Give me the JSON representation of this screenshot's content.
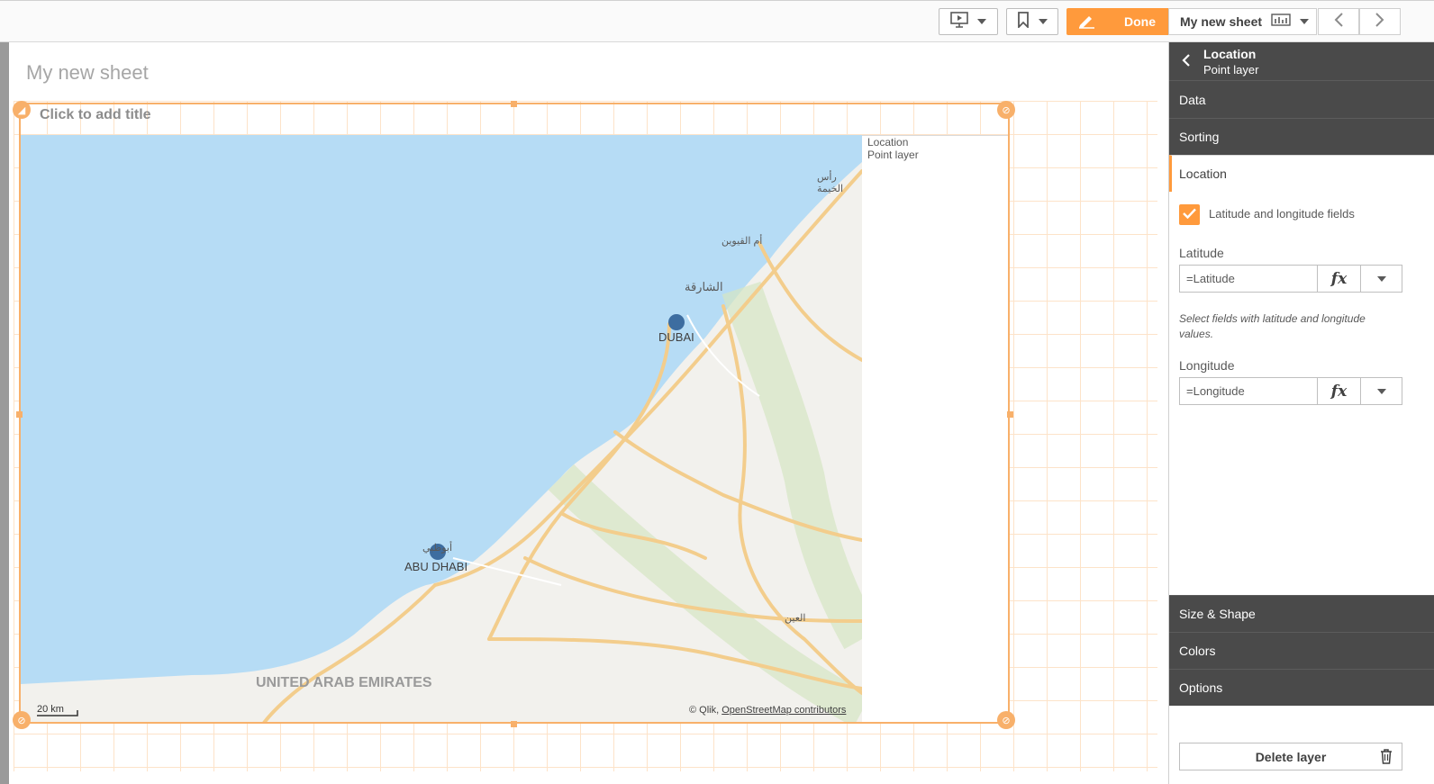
{
  "toolbar": {
    "done_label": "Done",
    "sheet_name": "My new sheet"
  },
  "sheet": {
    "title": "My new sheet",
    "object_title_placeholder": "Click to add title"
  },
  "map": {
    "legend_title": "Location",
    "legend_subtitle": "Point layer",
    "places": {
      "dubai": "DUBAI",
      "abu_dhabi": "ABU DHABI",
      "country": "UNITED ARAB EMIRATES",
      "sharjah_ar": "الشارقة",
      "umm_al_quwain_ar": "أم القيوين",
      "ras_al_khaimah_ar": "رأس الخيمة",
      "al_ain_ar": "العين",
      "abu_dhabi_ar": "أبوظبي"
    },
    "scale_label": "20 km",
    "attribution_prefix": "© Qlik, ",
    "attribution_link": "OpenStreetMap contributors",
    "points": [
      {
        "name": "Dubai",
        "lat": 25.2,
        "lon": 55.27
      },
      {
        "name": "Abu Dhabi",
        "lat": 24.45,
        "lon": 54.37
      }
    ],
    "colors": {
      "water": "#b6dcf5",
      "land": "#f2f1ed",
      "road": "#f3cd8c",
      "green": "#d6e6c3",
      "point": "#3d6da0"
    }
  },
  "panel": {
    "header_title": "Location",
    "header_subtitle": "Point layer",
    "sections_top": [
      "Data",
      "Sorting",
      "Location"
    ],
    "checkbox_label": "Latitude and longitude fields",
    "latitude_label": "Latitude",
    "latitude_value": "=Latitude",
    "hint": "Select fields with latitude and longitude values.",
    "longitude_label": "Longitude",
    "longitude_value": "=Longitude",
    "fx_label": "fx",
    "sections_bottom": [
      "Size & Shape",
      "Colors",
      "Options"
    ],
    "delete_label": "Delete layer"
  },
  "accent_color": "#ff9a3c"
}
